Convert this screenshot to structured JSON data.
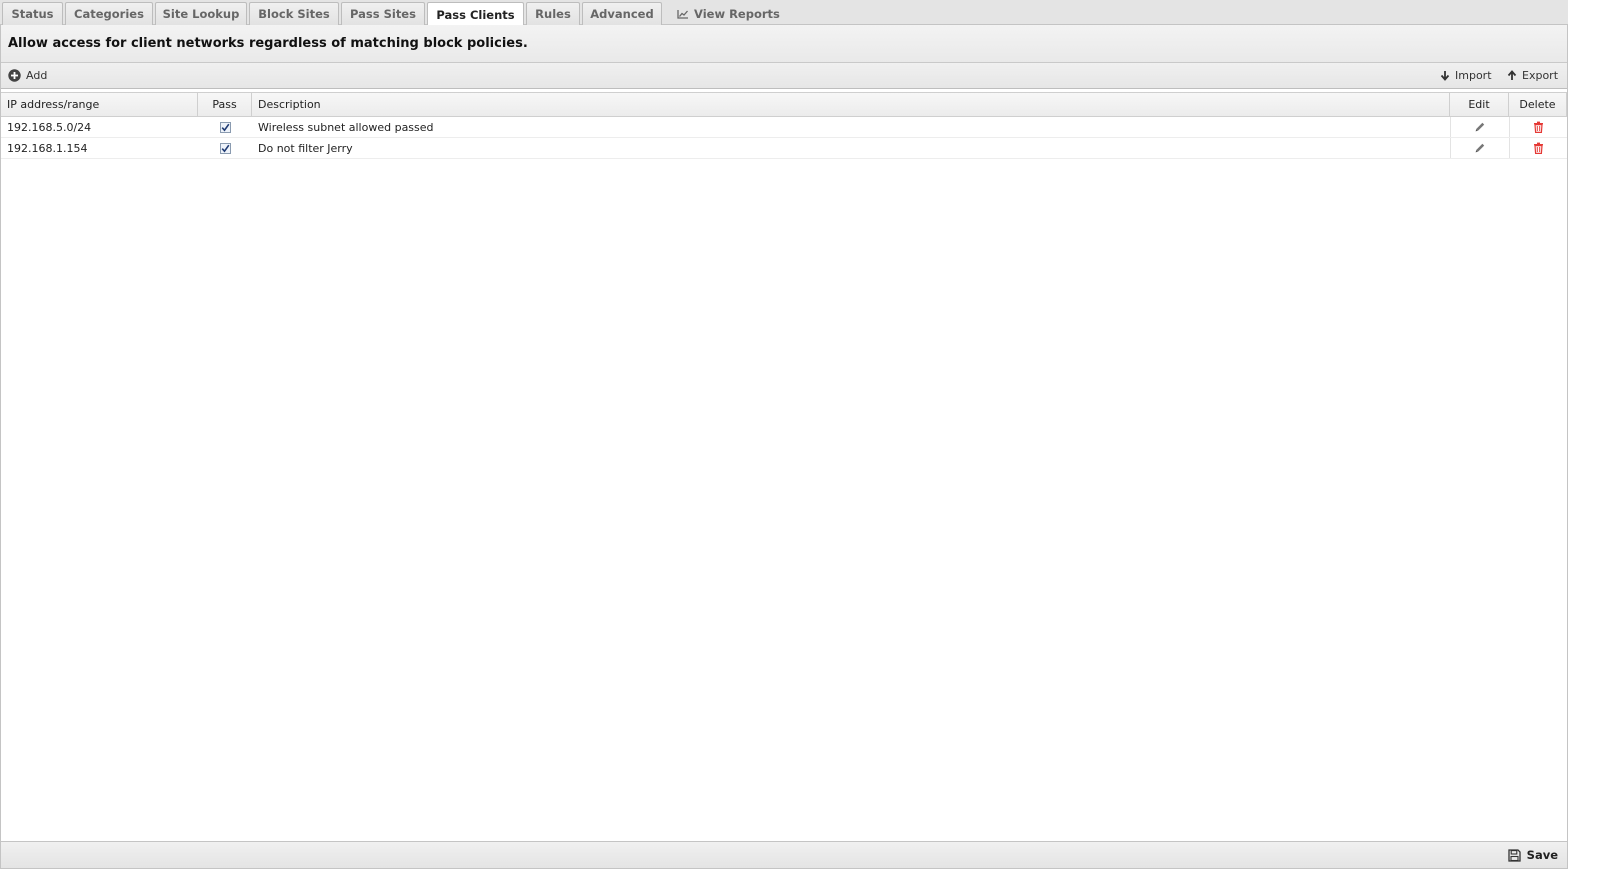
{
  "tabs": [
    {
      "label": "Status"
    },
    {
      "label": "Categories"
    },
    {
      "label": "Site Lookup"
    },
    {
      "label": "Block Sites"
    },
    {
      "label": "Pass Sites"
    },
    {
      "label": "Pass Clients",
      "active": true
    },
    {
      "label": "Rules"
    },
    {
      "label": "Advanced"
    },
    {
      "label": "View Reports",
      "icon": "line-chart-icon"
    }
  ],
  "panel": {
    "heading": "Allow access for client networks regardless of matching block policies."
  },
  "toolbar": {
    "add_label": "Add",
    "import_label": "Import",
    "export_label": "Export"
  },
  "grid": {
    "columns": [
      "IP address/range",
      "Pass",
      "Description",
      "Edit",
      "Delete"
    ],
    "rows": [
      {
        "ip": "192.168.5.0/24",
        "pass": true,
        "description": "Wireless subnet allowed passed"
      },
      {
        "ip": "192.168.1.154",
        "pass": true,
        "description": "Do not filter Jerry"
      }
    ]
  },
  "footer": {
    "save_label": "Save"
  },
  "colors": {
    "delete_icon": "#e53935",
    "edit_icon": "#777777",
    "checkbox_border": "#8a9bb0"
  }
}
